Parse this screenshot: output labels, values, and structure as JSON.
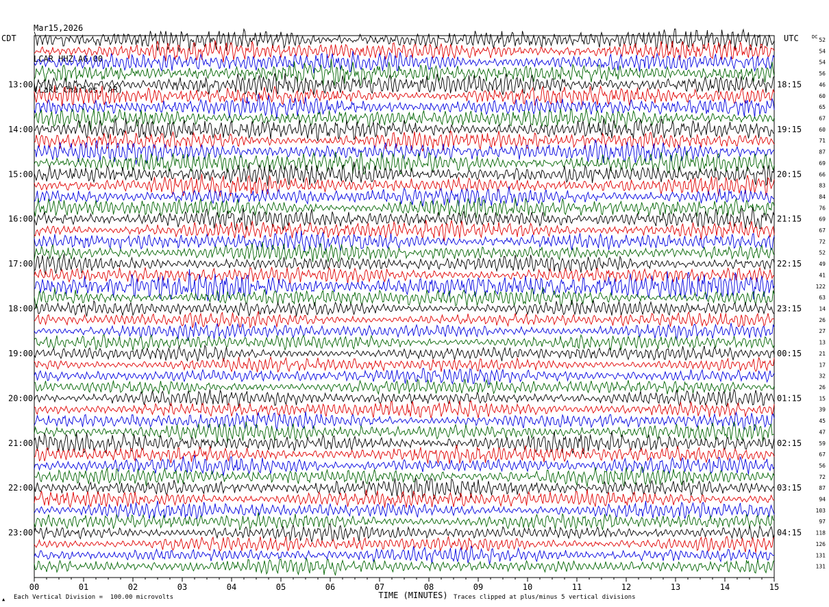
{
  "header": {
    "date": "Mar15,2026",
    "station": "LCAR HHZ AG 00",
    "location": "(Lake Charles, AR)"
  },
  "footer": {
    "left_note": "Each Vertical Division =  100.00 microvolts",
    "right_note": "Traces clipped at plus/minus 5 vertical divisions",
    "corner_mark": "▲"
  },
  "colors": {
    "trace_cycle": [
      "#000000",
      "#e00000",
      "#0000e0",
      "#006400"
    ],
    "text": "#000000"
  },
  "chart_data": {
    "type": "line",
    "title": "",
    "xlabel": "TIME (MINUTES)",
    "ylabel": "",
    "left_axis_label": "CDT",
    "right_axis_label": "UTC",
    "dc_label": "DC",
    "xlim": [
      0,
      15
    ],
    "x_ticks": [
      "00",
      "01",
      "02",
      "03",
      "04",
      "05",
      "06",
      "07",
      "08",
      "09",
      "10",
      "11",
      "12",
      "13",
      "14",
      "15"
    ],
    "trace_count": 48,
    "minutes_per_trace": 15,
    "left_time_labels": [
      {
        "trace": 4,
        "label": "13:00"
      },
      {
        "trace": 8,
        "label": "14:00"
      },
      {
        "trace": 12,
        "label": "15:00"
      },
      {
        "trace": 16,
        "label": "16:00"
      },
      {
        "trace": 20,
        "label": "17:00"
      },
      {
        "trace": 24,
        "label": "18:00"
      },
      {
        "trace": 28,
        "label": "19:00"
      },
      {
        "trace": 32,
        "label": "20:00"
      },
      {
        "trace": 36,
        "label": "21:00"
      },
      {
        "trace": 40,
        "label": "22:00"
      },
      {
        "trace": 44,
        "label": "23:00"
      }
    ],
    "right_time_labels": [
      {
        "trace": 4,
        "label": "18:15"
      },
      {
        "trace": 8,
        "label": "19:15"
      },
      {
        "trace": 12,
        "label": "20:15"
      },
      {
        "trace": 16,
        "label": "21:15"
      },
      {
        "trace": 20,
        "label": "22:15"
      },
      {
        "trace": 24,
        "label": "23:15"
      },
      {
        "trace": 28,
        "label": "00:15"
      },
      {
        "trace": 32,
        "label": "01:15"
      },
      {
        "trace": 36,
        "label": "02:15"
      },
      {
        "trace": 40,
        "label": "03:15"
      },
      {
        "trace": 44,
        "label": "04:15"
      }
    ],
    "dc_offsets": [
      "52",
      "54",
      "54",
      "56",
      "46",
      "60",
      "65",
      "67",
      "60",
      "71",
      "87",
      "69",
      "66",
      "83",
      "84",
      "76",
      "69",
      "67",
      "72",
      "52",
      "49",
      "41",
      "122",
      "63",
      "14",
      "26",
      "27",
      "13",
      "21",
      "17",
      "32",
      "26",
      "15",
      "39",
      "45",
      "47",
      "59",
      "67",
      "56",
      "72",
      "87",
      "94",
      "103",
      "97",
      "118",
      "126",
      "131",
      "131"
    ],
    "trace_activity": [
      0.8,
      0.75,
      0.75,
      0.85,
      0.85,
      0.75,
      0.75,
      0.75,
      0.8,
      0.75,
      0.75,
      0.85,
      0.8,
      0.7,
      0.7,
      0.75,
      0.75,
      0.7,
      0.7,
      0.65,
      0.6,
      0.6,
      1.0,
      0.7,
      0.55,
      0.5,
      0.55,
      0.55,
      0.5,
      0.5,
      0.55,
      0.55,
      0.55,
      0.6,
      0.6,
      0.65,
      0.7,
      0.65,
      0.6,
      0.65,
      0.7,
      0.65,
      0.6,
      0.6,
      0.55,
      0.55,
      0.55,
      0.55
    ],
    "grid": false
  }
}
